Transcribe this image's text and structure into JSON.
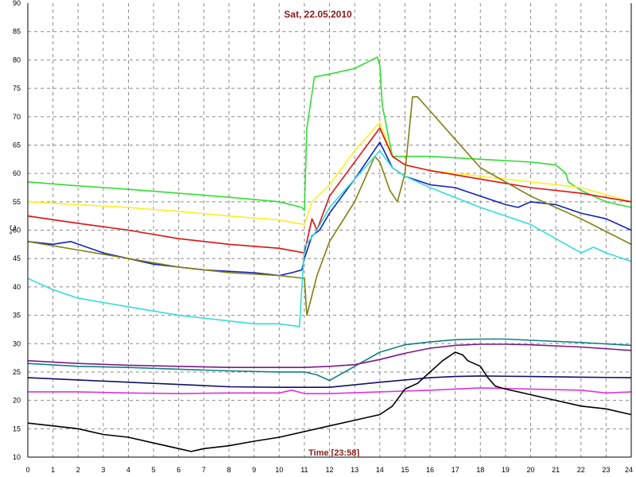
{
  "chart_data": {
    "type": "line",
    "title": "Sat, 22.05.2010",
    "xlabel": "Time [23:58]",
    "ylabel": "°C",
    "xlim": [
      0,
      24
    ],
    "ylim": [
      10,
      90
    ],
    "x_ticks": [
      "0",
      "1",
      "2",
      "3",
      "4",
      "5",
      "6",
      "7",
      "8",
      "9",
      "10",
      "11",
      "12",
      "13",
      "14",
      "15",
      "16",
      "17",
      "18",
      "19",
      "20",
      "21",
      "22",
      "23",
      "24"
    ],
    "y_ticks": [
      "10",
      "15",
      "20",
      "25",
      "30",
      "35",
      "40",
      "45",
      "50",
      "55",
      "60",
      "65",
      "70",
      "75",
      "80",
      "85",
      "90"
    ],
    "grid": true,
    "series": [
      {
        "color": "#33dd33",
        "x": [
          0,
          2,
          4,
          6,
          8,
          10,
          10.9,
          11,
          11.1,
          11.4,
          12,
          13,
          13.9,
          14,
          14.1,
          14.5,
          15,
          16,
          18,
          20,
          21,
          21.4,
          21.5,
          22,
          23,
          24
        ],
        "y": [
          58.5,
          57.8,
          57.2,
          56.5,
          55.8,
          55,
          54,
          53.5,
          68,
          77,
          77.5,
          78.5,
          80.5,
          79,
          72,
          63,
          63,
          63,
          62.5,
          62,
          61.5,
          60,
          58.5,
          57,
          55,
          54
        ]
      },
      {
        "color": "#ffee22",
        "x": [
          0,
          2,
          4,
          6,
          8,
          10,
          11,
          11.3,
          12,
          13,
          14,
          14.5,
          15,
          16,
          18,
          20,
          22,
          24
        ],
        "y": [
          55,
          54.5,
          54,
          53.3,
          52.5,
          51.8,
          51,
          55,
          58,
          64,
          69,
          63,
          61.5,
          60.5,
          59.5,
          58.5,
          57.5,
          55
        ]
      },
      {
        "color": "#dd1111",
        "x": [
          0,
          2,
          4,
          6,
          8,
          10,
          11,
          11.1,
          11.3,
          11.5,
          12,
          13,
          14,
          14.5,
          15,
          16,
          18,
          20,
          22,
          24
        ],
        "y": [
          52.5,
          51.2,
          50,
          48.5,
          47.5,
          46.8,
          46,
          48,
          52,
          50,
          56,
          62,
          68,
          63,
          61.5,
          60.5,
          59,
          57.5,
          56.5,
          55
        ]
      },
      {
        "color": "#1122bb",
        "x": [
          0,
          1,
          1.7,
          3,
          5,
          7,
          9,
          10,
          10.5,
          10.9,
          11,
          11.3,
          11.6,
          12,
          13,
          14,
          14.5,
          15,
          16,
          17,
          18,
          19,
          19.5,
          20,
          21,
          22,
          23,
          24
        ],
        "y": [
          48,
          47.5,
          48,
          46,
          44,
          43,
          42.5,
          42,
          42.5,
          43,
          45,
          49,
          50,
          53,
          59,
          65.5,
          61,
          59.5,
          58,
          57.5,
          56,
          54.5,
          54,
          55,
          54.5,
          53,
          52,
          50
        ]
      },
      {
        "color": "#808010",
        "x": [
          0,
          2,
          4,
          6,
          8,
          10,
          11,
          11.1,
          11.5,
          12,
          13,
          13.8,
          14,
          14.4,
          14.7,
          15,
          15.3,
          15.5,
          16,
          17,
          18,
          20,
          22,
          24
        ],
        "y": [
          48,
          46.5,
          45,
          43.5,
          42.5,
          42,
          41.5,
          35,
          42,
          48,
          55,
          63,
          62,
          57,
          55,
          60,
          73.5,
          73.5,
          71,
          66,
          61,
          56,
          52,
          47.5
        ]
      },
      {
        "color": "#33dddd",
        "x": [
          0,
          1,
          2,
          4,
          6,
          8,
          9,
          10,
          10.8,
          11,
          11.5,
          12,
          13,
          14,
          14.5,
          15,
          16,
          18,
          20,
          21,
          22,
          22.5,
          23,
          24
        ],
        "y": [
          41.5,
          39.5,
          38,
          36.5,
          35,
          34,
          33.5,
          33.5,
          33,
          47,
          50,
          54,
          59,
          64,
          61,
          59.5,
          57.5,
          54,
          51,
          48.5,
          46,
          47,
          46,
          44.5
        ]
      },
      {
        "color": "#118080",
        "x": [
          0,
          2,
          4,
          6,
          8,
          10,
          11,
          11.5,
          12,
          13,
          14,
          15,
          16,
          17,
          18,
          19,
          20,
          22,
          24
        ],
        "y": [
          26.5,
          26,
          25.8,
          25.5,
          25.2,
          25,
          25,
          24.5,
          23.5,
          26,
          28.5,
          29.8,
          30.3,
          30.7,
          30.8,
          30.8,
          30.6,
          30.2,
          29.7
        ]
      },
      {
        "color": "#7a1a8a",
        "x": [
          0,
          2,
          4,
          6,
          8,
          10,
          11,
          12,
          13,
          14,
          15,
          16,
          17,
          18,
          19,
          20,
          22,
          24
        ],
        "y": [
          27,
          26.5,
          26.2,
          26,
          25.8,
          25.8,
          25.8,
          26,
          26.3,
          27.2,
          28.3,
          29.2,
          29.7,
          29.9,
          29.9,
          29.8,
          29.4,
          28.8
        ]
      },
      {
        "color": "#10106a",
        "x": [
          0,
          2,
          4,
          6,
          8,
          10,
          12,
          14,
          16,
          17,
          18,
          20,
          22,
          24
        ],
        "y": [
          24,
          23.6,
          23.2,
          22.8,
          22.4,
          22.3,
          22.3,
          23.2,
          24,
          24.2,
          24.3,
          24.2,
          24.1,
          24
        ]
      },
      {
        "color": "#dd33dd",
        "x": [
          0,
          2,
          4,
          6,
          8,
          10,
          10.5,
          11,
          12,
          14,
          16,
          18,
          20,
          22,
          23,
          24
        ],
        "y": [
          21.5,
          21.5,
          21.3,
          21.2,
          21.3,
          21.3,
          21.8,
          21.2,
          21.2,
          21.5,
          21.8,
          22.2,
          22,
          21.8,
          21.3,
          21.5
        ]
      },
      {
        "color": "#000000",
        "x": [
          0,
          1,
          2,
          3,
          4,
          5,
          6,
          6.5,
          7,
          8,
          9,
          10,
          11,
          12,
          13,
          14,
          14.5,
          15,
          15.5,
          16,
          16.5,
          17,
          17.3,
          17.5,
          18,
          18.3,
          18.6,
          19,
          19.5,
          20,
          21,
          22,
          23,
          24
        ],
        "y": [
          16,
          15.5,
          15,
          14,
          13.5,
          12.5,
          11.5,
          11,
          11.5,
          12,
          12.8,
          13.5,
          14.5,
          15.5,
          16.5,
          17.5,
          19,
          22,
          23,
          25,
          27,
          28.5,
          28,
          27,
          26,
          24,
          22.5,
          22,
          21.5,
          21,
          20,
          19,
          18.5,
          17.5
        ]
      }
    ]
  }
}
